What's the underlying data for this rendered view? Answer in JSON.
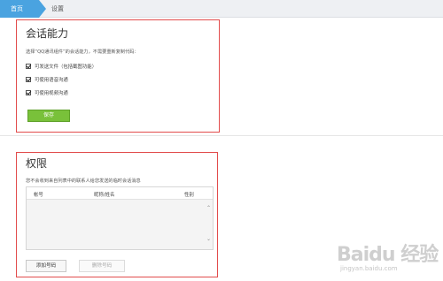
{
  "nav": {
    "home_label": "首页",
    "settings_label": "设置"
  },
  "session": {
    "title": "会话能力",
    "description": "选择“QQ通讯组件”的会话能力，不需要重新复制代码：",
    "options": [
      {
        "label": "可发送文件（包括截图功能）",
        "checked": true
      },
      {
        "label": "可使用语音沟通",
        "checked": true
      },
      {
        "label": "可使用视频沟通",
        "checked": true
      }
    ],
    "save_label": "保存"
  },
  "permissions": {
    "title": "权限",
    "description": "您不会收到来自列表中的联系人给您发送的临时会话消息",
    "columns": [
      "帐号",
      "昵称/姓名",
      "性别"
    ],
    "add_label": "添加号码",
    "delete_label": "删除号码"
  },
  "watermark": {
    "logo_text": "Baidu 经验",
    "url_text": "jingyan.baidu.com"
  },
  "colors": {
    "accent_blue": "#4aa3e0",
    "save_green": "#79c13a",
    "highlight_red": "#e24c4c"
  }
}
